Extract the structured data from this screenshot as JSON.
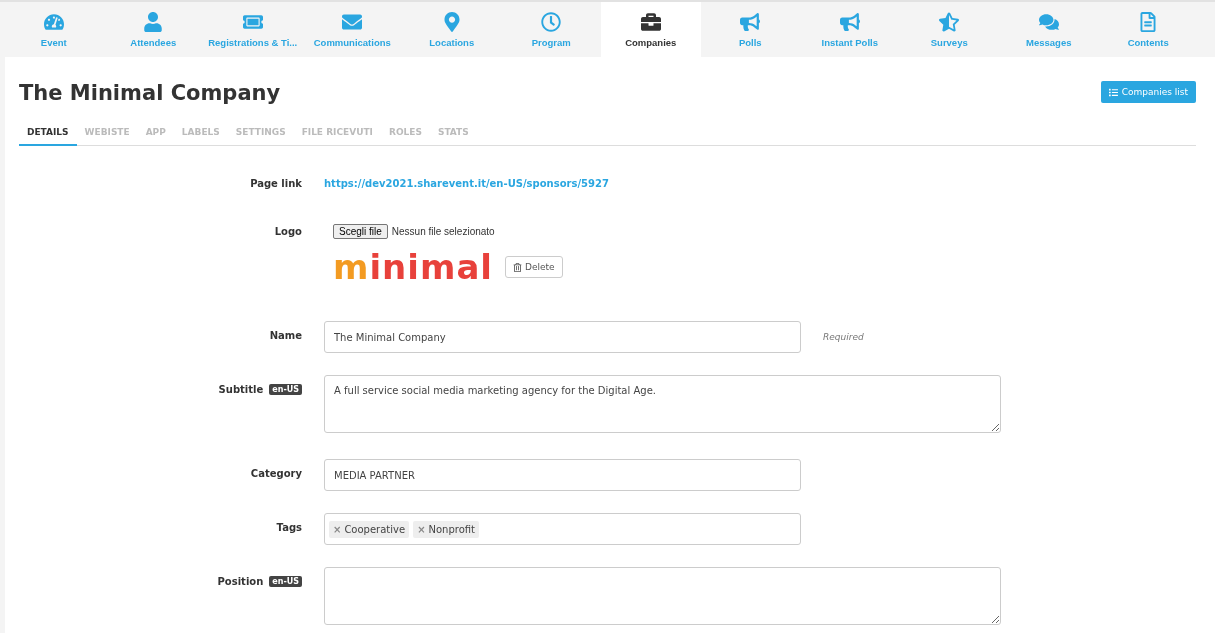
{
  "nav": [
    {
      "label": "Event",
      "selected": false
    },
    {
      "label": "Attendees",
      "selected": false
    },
    {
      "label": "Registrations & Ti...",
      "selected": false
    },
    {
      "label": "Communications",
      "selected": false
    },
    {
      "label": "Locations",
      "selected": false
    },
    {
      "label": "Program",
      "selected": false
    },
    {
      "label": "Companies",
      "selected": true
    },
    {
      "label": "Polls",
      "selected": false
    },
    {
      "label": "Instant Polls",
      "selected": false
    },
    {
      "label": "Surveys",
      "selected": false
    },
    {
      "label": "Messages",
      "selected": false
    },
    {
      "label": "Contents",
      "selected": false
    }
  ],
  "title": "The Minimal Company",
  "list_button": "Companies list",
  "tabs": [
    {
      "label": "DETAILS",
      "selected": true
    },
    {
      "label": "WEBISTE",
      "selected": false
    },
    {
      "label": "APP",
      "selected": false
    },
    {
      "label": "LABELS",
      "selected": false
    },
    {
      "label": "SETTINGS",
      "selected": false
    },
    {
      "label": "FILE RICEVUTI",
      "selected": false
    },
    {
      "label": "ROLES",
      "selected": false
    },
    {
      "label": "STATS",
      "selected": false
    }
  ],
  "fields": [
    {
      "kind": "link",
      "label": "Page link",
      "value": "https://dev2021.sharevent.it/en-US/sponsors/5927"
    },
    {
      "kind": "file",
      "label": "Logo",
      "button": "Scegli file",
      "status": "Nessun file selezionato",
      "logo_text": "minimal",
      "delete": "Delete"
    },
    {
      "kind": "input",
      "label": "Name",
      "value": "The Minimal Company",
      "help": "Required"
    },
    {
      "kind": "textarea",
      "label": "Subtitle",
      "badge": "en-US",
      "value": "A full service social media marketing agency for the Digital Age."
    },
    {
      "kind": "input",
      "label": "Category",
      "value": "MEDIA PARTNER"
    },
    {
      "kind": "tags",
      "label": "Tags",
      "tags": [
        {
          "remove": "×",
          "text": "Cooperative"
        },
        {
          "remove": "×",
          "text": "Nonprofit"
        }
      ]
    },
    {
      "kind": "textarea",
      "label": "Position",
      "badge": "en-US"
    }
  ]
}
